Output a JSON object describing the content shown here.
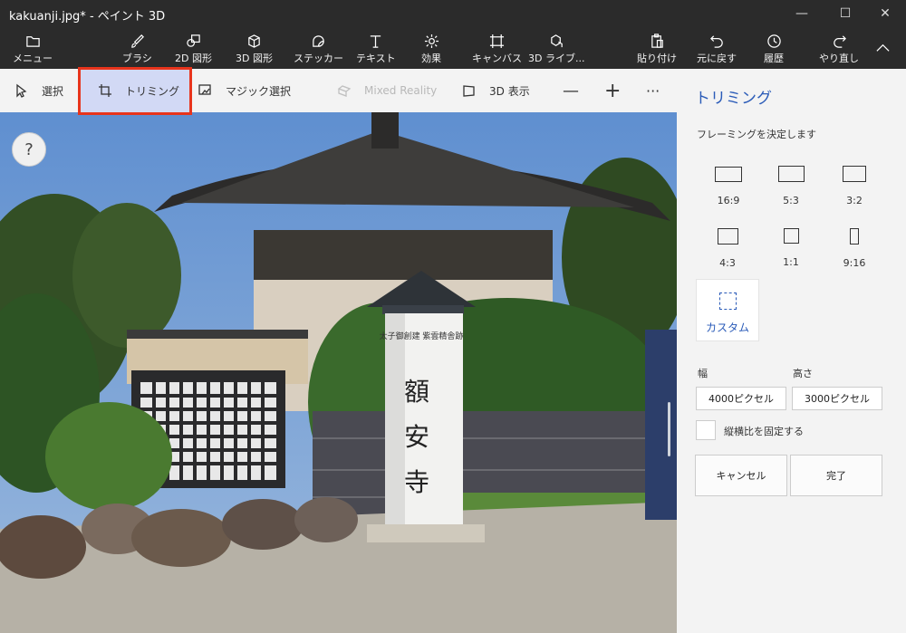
{
  "window": {
    "title": "kakuanji.jpg* - ペイント 3D",
    "minimize": "—",
    "maximize": "☐",
    "close": "✕"
  },
  "ribbon": {
    "menu": "メニュー",
    "brushes": "ブラシ",
    "shapes2d": "2D 図形",
    "shapes3d": "3D 図形",
    "stickers": "ステッカー",
    "text": "テキスト",
    "effects": "効果",
    "canvas": "キャンバス",
    "library3d": "3D ライブ...",
    "paste": "貼り付け",
    "undo": "元に戻す",
    "history": "履歴",
    "redo": "やり直し"
  },
  "toolbar": {
    "select": "選択",
    "crop": "トリミング",
    "magic_select": "マジック選択",
    "mixed_reality": "Mixed Reality",
    "view3d": "3D 表示",
    "zoom_out": "—",
    "zoom_in": "+",
    "more": "···"
  },
  "canvas": {
    "help": "?"
  },
  "panel": {
    "title": "トリミング",
    "subtitle": "フレーミングを決定します",
    "ratios": [
      "16:9",
      "5:3",
      "3:2",
      "4:3",
      "1:1",
      "9:16"
    ],
    "custom": "カスタム",
    "width_label": "幅",
    "height_label": "高さ",
    "width_value": "4000ピクセル",
    "height_value": "3000ピクセル",
    "lock_aspect": "縦横比を固定する",
    "cancel": "キャンセル",
    "done": "完了"
  },
  "photo": {
    "pillar_text_small": "太子御創建 紫雲精舎跡",
    "pillar_chars": [
      "額",
      "安",
      "寺"
    ]
  },
  "colors": {
    "accent": "#2a5bb8",
    "highlight": "#e8341c",
    "selected_bg": "#d2d9f5"
  }
}
